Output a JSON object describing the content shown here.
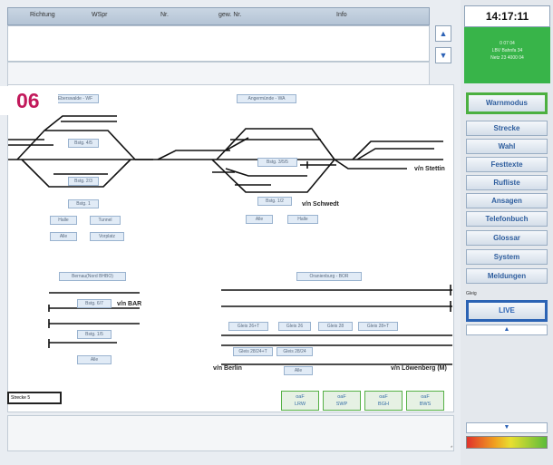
{
  "header": {
    "columns": [
      "Richtung",
      "WSpr",
      "Nr.",
      "gew. Nr.",
      "Info"
    ]
  },
  "tag": "06",
  "clock": "14:17:11",
  "status_panel": {
    "lines": [
      "0 07 04",
      "LBV Bahnfa 34",
      "Netz 23 4000 04"
    ]
  },
  "side_buttons": {
    "warnmodus": "Warnmodus",
    "strecke": "Strecke",
    "wahl": "Wahl",
    "festtexte": "Festtexte",
    "rufliste": "Rufliste",
    "ansagen": "Ansagen",
    "telefonbuch": "Telefonbuch",
    "glossar": "Glossar",
    "system": "System",
    "meldungen": "Meldungen",
    "live": "LIVE",
    "small_label": "Gleig"
  },
  "arrows": {
    "up": "▲",
    "down": "▼"
  },
  "diagram": {
    "station_top_left": "Eberswalde - WF",
    "station_top_right": "Angermünde - WA",
    "station_mid_left": "Bernau(Nord BHBO)",
    "station_mid_right": "Oranienburg - BOR",
    "btns": {
      "bstg45": "Bstg. 4/5",
      "bstg23": "Bstg. 2/3",
      "bstg1": "Bstg. 1",
      "halle": "Halle",
      "tunnel": "Tunnel",
      "alle1": "Alle",
      "vorplatz": "Vorplatz",
      "bstg35": "Bstg. 3/5/5",
      "bstg12": "Bstg. 1/2",
      "alle2": "Alle",
      "halle2": "Halle",
      "bstg67": "Bstg. 6/7",
      "bstg1b": "Bstg. 1/5",
      "alle3": "Alle",
      "gleis1": "Gleis 26+T",
      "gleis2": "Gleis 26",
      "gleis3": "Gleis 28",
      "gleis4": "Gleis 28+T",
      "gleis5": "Gleis 28/24+T",
      "gleis6": "Gleis 28/24",
      "alle4": "Alle"
    },
    "labels": {
      "stettin": "v/n Stettin",
      "schwedt": "v/n Schwedt",
      "bar": "v/n BAR",
      "berlin": "v/n Berlin",
      "loewenberg": "v/n Löwenberg (M)"
    },
    "green_buttons": [
      {
        "line1": "oaF",
        "line2": "LRW"
      },
      {
        "line1": "oaF",
        "line2": "SWP"
      },
      {
        "line1": "oaF",
        "line2": "BGH"
      },
      {
        "line1": "oaF",
        "line2": "BWS"
      }
    ],
    "strecke_box": "Strecke 5"
  },
  "corner_mark": "*",
  "colors": {
    "accent_green": "#38b449",
    "live_blue": "#2b63b4",
    "tag_pink": "#c2195b"
  }
}
